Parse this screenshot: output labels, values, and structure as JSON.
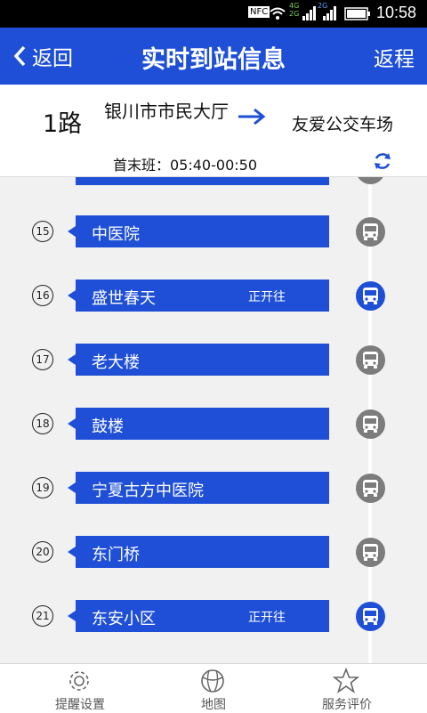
{
  "status_bar": {
    "time": "10:58",
    "nfc": "NFC",
    "net_top": "4G",
    "net_bottom": "2G",
    "net2": "2G"
  },
  "nav": {
    "back_label": "返回",
    "title": "实时到站信息",
    "return_label": "返程"
  },
  "route": {
    "line": "1路",
    "from": "银川市市民大厅",
    "to": "友爱公交车场",
    "schedule": "首末班：05:40-00:50"
  },
  "stations": [
    {
      "num": "15",
      "name": "中医院",
      "status": "",
      "bus_active": false
    },
    {
      "num": "16",
      "name": "盛世春天",
      "status": "正开往",
      "bus_active": true
    },
    {
      "num": "17",
      "name": "老大楼",
      "status": "",
      "bus_active": false
    },
    {
      "num": "18",
      "name": "鼓楼",
      "status": "",
      "bus_active": false
    },
    {
      "num": "19",
      "name": "宁夏古方中医院",
      "status": "",
      "bus_active": false
    },
    {
      "num": "20",
      "name": "东门桥",
      "status": "",
      "bus_active": false
    },
    {
      "num": "21",
      "name": "东安小区",
      "status": "正开往",
      "bus_active": true
    }
  ],
  "tabs": [
    {
      "label": "提醒设置",
      "icon": "gear-icon"
    },
    {
      "label": "地图",
      "icon": "ball-icon"
    },
    {
      "label": "服务评价",
      "icon": "star-icon"
    }
  ],
  "colors": {
    "primary": "#1e4fd6",
    "idle_bus": "#7c7c7c",
    "background": "#f1f1f1"
  }
}
